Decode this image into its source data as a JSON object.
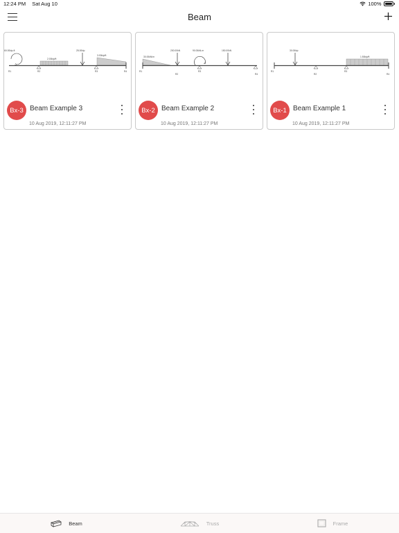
{
  "status_bar": {
    "time": "12:24 PM",
    "date": "Sat Aug 10",
    "battery": "100%"
  },
  "nav": {
    "title": "Beam"
  },
  "icons": {
    "menu": "hamburger-icon",
    "add": "plus-icon",
    "more": "vertical-ellipsis-icon",
    "wifi": "wifi-icon",
    "battery": "battery-icon"
  },
  "colors": {
    "badge": "#e14b4b",
    "tab_active": "#333333",
    "tab_inactive": "#aaaaaa"
  },
  "cards": [
    {
      "badge": "Bx-3",
      "title": "Beam Example 3",
      "date": "10 Aug 2019, 12:11:27 PM",
      "diagram_labels": [
        "60.00kip-ft",
        "2.00kip/ft",
        "25.00kip",
        "3.00kip/ft",
        "R1",
        "R2",
        "R3",
        "R4"
      ]
    },
    {
      "badge": "Bx-2",
      "title": "Beam Example 2",
      "date": "10 Aug 2019, 12:11:27 PM",
      "diagram_labels": [
        "30.00kN/m",
        "200.00kN",
        "90.00kN-m",
        "150.00kN",
        "R1",
        "R2",
        "R3",
        "R4"
      ]
    },
    {
      "badge": "Bx-1",
      "title": "Beam Example 1",
      "date": "10 Aug 2019, 12:11:27 PM",
      "diagram_labels": [
        "30.00kip",
        "1.50kip/ft",
        "R1",
        "R2",
        "R3",
        "R4"
      ]
    }
  ],
  "tabs": [
    {
      "label": "Beam",
      "icon": "beam-icon",
      "active": true
    },
    {
      "label": "Truss",
      "icon": "truss-icon",
      "active": false
    },
    {
      "label": "Frame",
      "icon": "frame-icon",
      "active": false
    }
  ]
}
